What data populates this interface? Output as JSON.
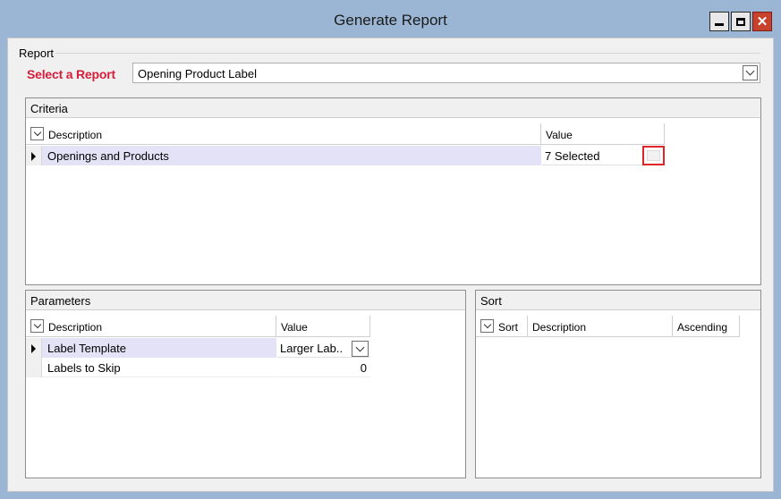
{
  "window": {
    "title": "Generate Report"
  },
  "report": {
    "group_label": "Report",
    "select_label": "Select a Report",
    "selected_value": "Opening Product Label"
  },
  "criteria": {
    "title": "Criteria",
    "columns": {
      "description": "Description",
      "value": "Value"
    },
    "rows": [
      {
        "description": "Openings and Products",
        "value": "7 Selected"
      }
    ]
  },
  "parameters": {
    "title": "Parameters",
    "columns": {
      "description": "Description",
      "value": "Value"
    },
    "rows": [
      {
        "description": "Label Template",
        "value": "Larger Lab.."
      },
      {
        "description": "Labels to Skip",
        "value": "0"
      }
    ]
  },
  "sort": {
    "title": "Sort",
    "columns": {
      "sort": "Sort",
      "description": "Description",
      "ascending": "Ascending"
    }
  },
  "colors": {
    "accent": "#d51d3c",
    "selected_row": "#e4e2f7",
    "highlight_border": "#e0242c"
  }
}
